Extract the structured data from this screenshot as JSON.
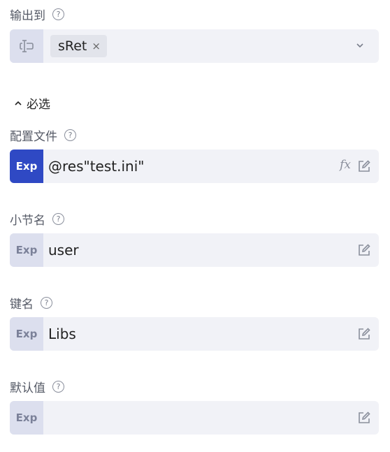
{
  "output": {
    "label": "输出到",
    "help": "?",
    "tag": "sRet",
    "tag_close": "×"
  },
  "section": {
    "label": "必选"
  },
  "fields": [
    {
      "label": "配置文件",
      "help": "?",
      "badge": "Exp",
      "value": "@res\"test.ini\"",
      "fx": "fx",
      "active": true
    },
    {
      "label": "小节名",
      "help": "?",
      "badge": "Exp",
      "value": "user"
    },
    {
      "label": "键名",
      "help": "?",
      "badge": "Exp",
      "value": "Libs"
    },
    {
      "label": "默认值",
      "help": "?",
      "badge": "Exp",
      "value": ""
    }
  ],
  "colors": {
    "exp_active": "#2f49c4",
    "exp_inactive": "#dcdfee",
    "field_bg": "#f1f2f7"
  },
  "icons": [
    "help-icon",
    "variable-icon",
    "close-icon",
    "chevron-down-icon",
    "caret-up-icon",
    "fx-icon",
    "edit-icon"
  ]
}
